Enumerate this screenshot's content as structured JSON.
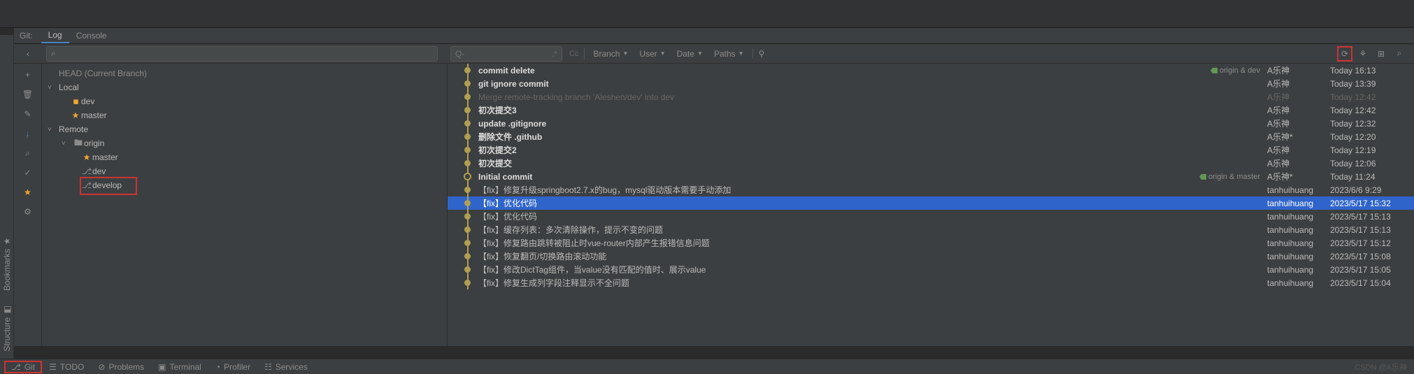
{
  "tabs": {
    "label": "Git:",
    "log": "Log",
    "console": "Console"
  },
  "search": {
    "placeholder": "Q-"
  },
  "filters": {
    "branch": "Branch",
    "user": "User",
    "date": "Date",
    "paths": "Paths"
  },
  "cc": "Cc",
  "tree": {
    "head": "HEAD (Current Branch)",
    "local": "Local",
    "dev": "dev",
    "master": "master",
    "remote": "Remote",
    "origin": "origin",
    "r_master": "master",
    "r_dev": "dev",
    "r_develop": "develop"
  },
  "commits": [
    {
      "msg": "commit delete",
      "author": "A乐神",
      "date": "Today 16:13",
      "bold": true,
      "dot": "dot",
      "tag": "origin & dev",
      "tagcolor": "green"
    },
    {
      "msg": "git ignore commit",
      "author": "A乐神",
      "date": "Today 13:39",
      "bold": true,
      "dot": "dot"
    },
    {
      "msg": "Merge remote-tracking branch 'Aleshen/dev' into dev",
      "author": "A乐神",
      "date": "Today 12:42",
      "bold": false,
      "dot": "dot",
      "dim": true
    },
    {
      "msg": "初次提交3",
      "author": "A乐神",
      "date": "Today 12:42",
      "bold": true,
      "dot": "dot"
    },
    {
      "msg": "update .gitignore",
      "author": "A乐神",
      "date": "Today 12:32",
      "bold": true,
      "dot": "dot"
    },
    {
      "msg": "删除文件 .github",
      "author": "A乐神*",
      "date": "Today 12:20",
      "bold": true,
      "dot": "dot"
    },
    {
      "msg": "初次提交2",
      "author": "A乐神",
      "date": "Today 12:19",
      "bold": true,
      "dot": "dot"
    },
    {
      "msg": "初次提交",
      "author": "A乐神",
      "date": "Today 12:06",
      "bold": true,
      "dot": "dot"
    },
    {
      "msg": "Initial commit",
      "author": "A乐神*",
      "date": "Today 11:24",
      "bold": true,
      "dot": "ring",
      "tag": "origin & master",
      "tagcolor": "green"
    },
    {
      "msg": "【fix】修复升级springboot2.7.x的bug，mysql驱动版本需要手动添加",
      "author": "tanhuihuang",
      "date": "2023/6/6 9:29",
      "dot": "dot"
    },
    {
      "msg": "【fix】优化代码",
      "author": "tanhuihuang",
      "date": "2023/5/17 15:32",
      "dot": "dot",
      "selected": true
    },
    {
      "msg": "【fix】优化代码",
      "author": "tanhuihuang",
      "date": "2023/5/17 15:13",
      "dot": "dot"
    },
    {
      "msg": "【fix】缓存列表：多次清除操作，提示不变的问题",
      "author": "tanhuihuang",
      "date": "2023/5/17 15:13",
      "dot": "dot"
    },
    {
      "msg": "【fix】修复路由跳转被阻止时vue-router内部产生报错信息问题",
      "author": "tanhuihuang",
      "date": "2023/5/17 15:12",
      "dot": "dot"
    },
    {
      "msg": "【fix】恢复翻页/切换路由滚动功能",
      "author": "tanhuihuang",
      "date": "2023/5/17 15:08",
      "dot": "dot"
    },
    {
      "msg": "【fix】修改DictTag组件，当value没有匹配的值时、展示value",
      "author": "tanhuihuang",
      "date": "2023/5/17 15:05",
      "dot": "dot"
    },
    {
      "msg": "【fix】修复生成列字段注释显示不全问题",
      "author": "tanhuihuang",
      "date": "2023/5/17 15:04",
      "dot": "dot"
    }
  ],
  "statusbar": {
    "git": "Git",
    "todo": "TODO",
    "problems": "Problems",
    "terminal": "Terminal",
    "profiler": "Profiler",
    "services": "Services"
  },
  "leftTabs": {
    "structure": "Structure",
    "bookmarks": "Bookmarks"
  },
  "watermark": "CSDN @A乐神"
}
